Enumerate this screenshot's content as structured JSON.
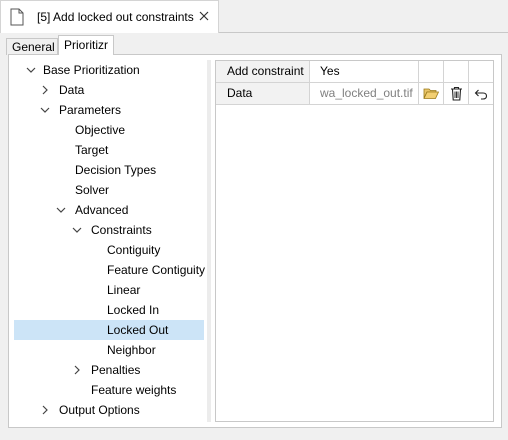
{
  "doc_tab": {
    "title": "[5] Add locked out constraints"
  },
  "subtabs": [
    {
      "label": "General"
    },
    {
      "label": "Prioritizr"
    }
  ],
  "tree": [
    {
      "label": "Base Prioritization"
    },
    {
      "label": "Data"
    },
    {
      "label": "Parameters"
    },
    {
      "label": "Objective"
    },
    {
      "label": "Target"
    },
    {
      "label": "Decision Types"
    },
    {
      "label": "Solver"
    },
    {
      "label": "Advanced"
    },
    {
      "label": "Constraints"
    },
    {
      "label": "Contiguity"
    },
    {
      "label": "Feature Contiguity"
    },
    {
      "label": "Linear"
    },
    {
      "label": "Locked In"
    },
    {
      "label": "Locked Out"
    },
    {
      "label": "Neighbor"
    },
    {
      "label": "Penalties"
    },
    {
      "label": "Feature weights"
    },
    {
      "label": "Output Options"
    }
  ],
  "grid": {
    "rows": [
      {
        "label": "Add constraint",
        "value": "Yes"
      },
      {
        "label": "Data",
        "value": "wa_locked_out.tif"
      }
    ]
  },
  "colors": {
    "selected": "#cce4f7",
    "folder": "#d9a520"
  }
}
